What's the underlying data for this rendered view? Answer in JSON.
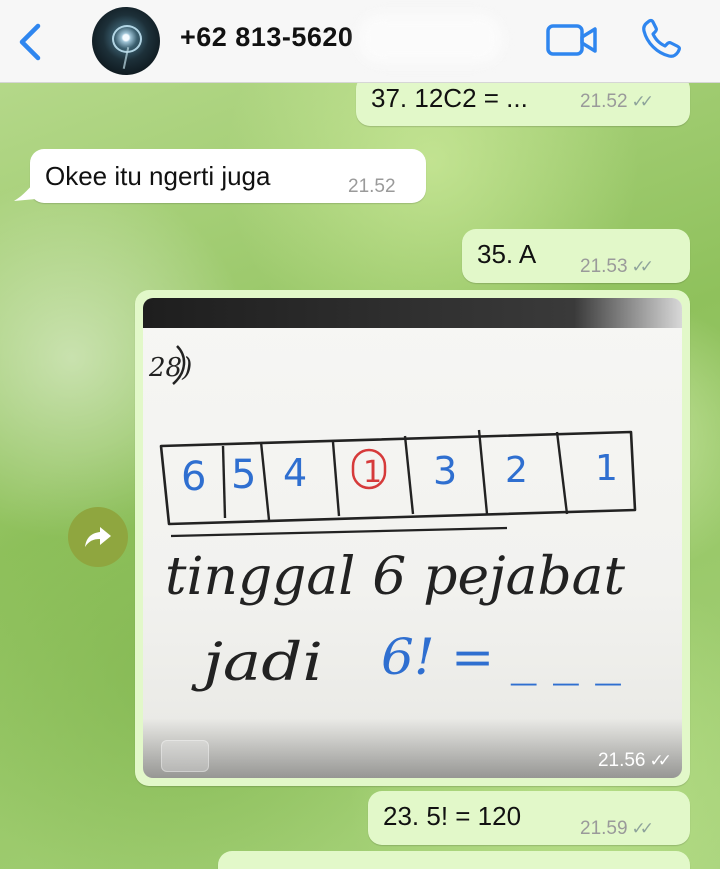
{
  "header": {
    "contact": "+62 813-5620",
    "colors": {
      "accent": "#3a8ff0",
      "header_bg": "#f7f7f7"
    }
  },
  "messages": [
    {
      "id": "m1",
      "direction": "out",
      "text": "37. 12C2 = ...",
      "time": "21.52",
      "status": "read"
    },
    {
      "id": "m2",
      "direction": "in",
      "text": "Okee itu ngerti juga",
      "time": "21.52"
    },
    {
      "id": "m3",
      "direction": "out",
      "text": "35. A",
      "time": "21.53",
      "status": "read"
    },
    {
      "id": "m4",
      "direction": "out",
      "type": "image",
      "time": "21.56",
      "status": "read",
      "image": {
        "problem_number": "28)",
        "boxes": [
          "6",
          "5",
          "4",
          "1",
          "3",
          "2",
          "1"
        ],
        "line1": "tinggal 6 pejabat",
        "line2_prefix": "jadi",
        "line2_value": "6! = _ _ _"
      }
    },
    {
      "id": "m5",
      "direction": "out",
      "text": "23. 5! = 120",
      "time": "21.59",
      "status": "read"
    }
  ],
  "icons": [
    "back-chevron-icon",
    "video-call-icon",
    "phone-icon",
    "forward-icon",
    "read-ticks-icon"
  ],
  "colors": {
    "outgoing_bubble": "#e2f8c9",
    "incoming_bubble": "#ffffff",
    "ink_black": "#222222",
    "ink_blue": "#2f6fd0",
    "ink_red": "#d63a3a"
  }
}
